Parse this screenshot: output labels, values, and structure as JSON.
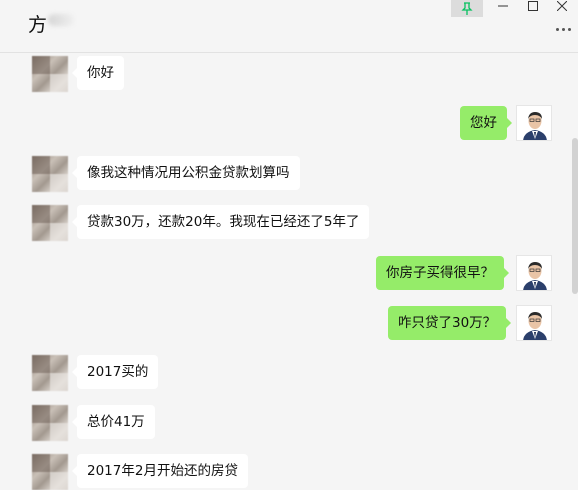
{
  "window": {
    "title": "方",
    "controls": [
      "pin-icon",
      "minimize-icon",
      "maximize-icon",
      "close-icon",
      "more-icon"
    ],
    "pin_color": "#07c160"
  },
  "colors": {
    "sent_bubble": "#95ec69",
    "received_bubble": "#ffffff",
    "background": "#f5f5f5"
  },
  "messages": [
    {
      "side": "left",
      "text": "你好"
    },
    {
      "side": "right",
      "text": "您好"
    },
    {
      "side": "left",
      "text": "像我这种情况用公积金贷款划算吗"
    },
    {
      "side": "left",
      "text": "贷款30万，还款20年。我现在已经还了5年了"
    },
    {
      "side": "right",
      "text": "你房子买得很早？"
    },
    {
      "side": "right",
      "text": "咋只贷了30万？"
    },
    {
      "side": "left",
      "text": "2017买的"
    },
    {
      "side": "left",
      "text": "总价41万"
    },
    {
      "side": "left",
      "text": "2017年2月开始还的房贷"
    }
  ]
}
